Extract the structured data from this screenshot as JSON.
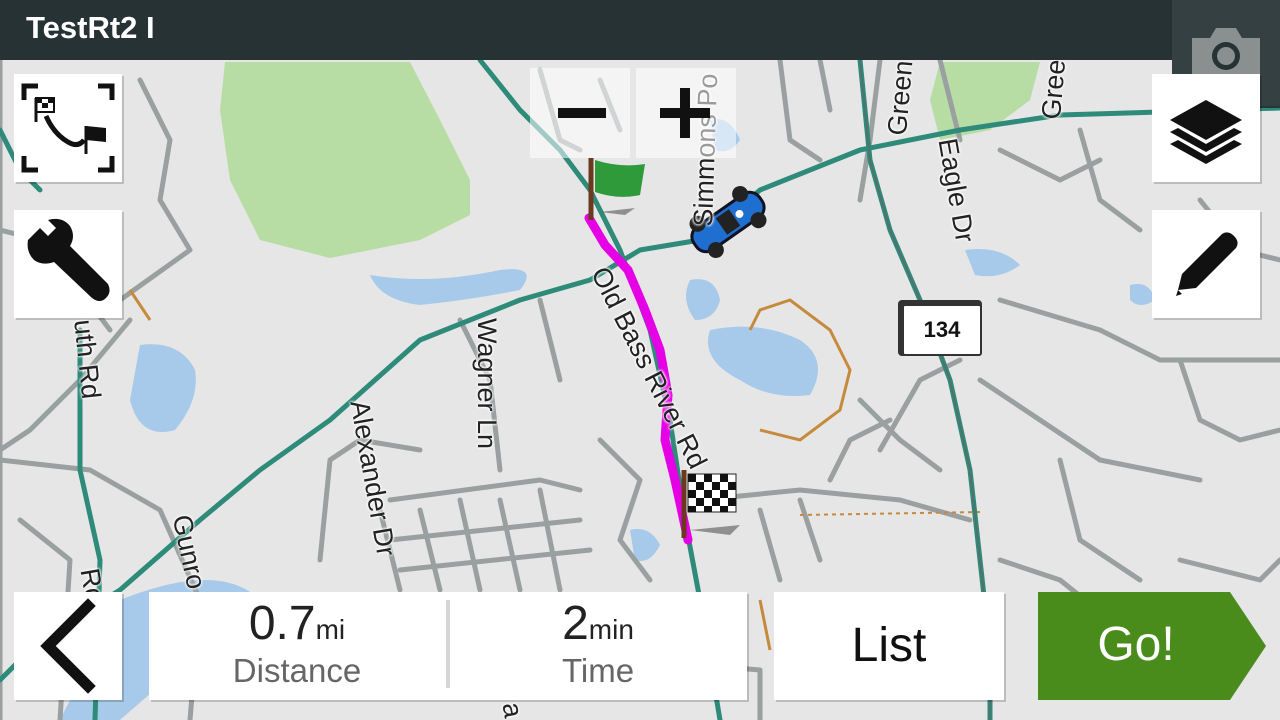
{
  "header": {
    "title": "TestRt2 I"
  },
  "map": {
    "road_labels": [
      "Old Bass River Rd",
      "Wagner Ln",
      "Alexander Dr",
      "Gunro",
      "Eagle Dr",
      "Green",
      "Gree",
      "Simmons Po",
      "uth Rd",
      "Rd",
      "a"
    ],
    "route_shield": "134",
    "colors": {
      "route": "#e600e6",
      "main_road": "#2e8b7a",
      "water": "#a7c9ea",
      "park": "#b7dca4",
      "street": "#9aa0a0",
      "trail": "#c58a3c"
    }
  },
  "controls": {
    "zoom_out_label": "−",
    "zoom_in_label": "+",
    "icons": [
      "route-overview-icon",
      "wrench-icon",
      "camera-icon",
      "layers-icon",
      "pencil-icon",
      "back-arrow-icon"
    ]
  },
  "summary": {
    "distance_value": "0.7",
    "distance_unit": "mi",
    "distance_label": "Distance",
    "time_value": "2",
    "time_unit": "min",
    "time_label": "Time"
  },
  "actions": {
    "list_label": "List",
    "go_label": "Go!",
    "go_color": "#4a8c1c"
  }
}
